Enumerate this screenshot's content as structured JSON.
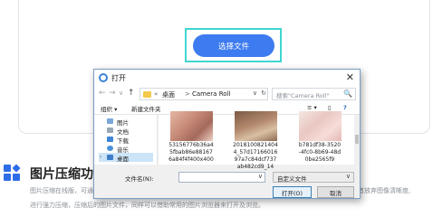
{
  "page": {
    "select_button": "选择文件",
    "feature_title": "图片压缩功能",
    "feature_desc_line1_left": "图片压缩在线版，可通",
    "feature_desc_line1_right": "者放弃图像清晰度,",
    "feature_desc_line2": "进行强力压缩，压缩后的图片文件，同样可以借助常用的图片浏览器来打开及浏览。"
  },
  "dialog": {
    "title": "打开",
    "close_glyph": "✕",
    "nav": {
      "back": "←",
      "forward": "→",
      "dropdown": "∨",
      "up": "↑"
    },
    "address": {
      "chevron": "«",
      "segments": [
        "桌面",
        "Camera Roll"
      ],
      "separator": ">",
      "dropdown": "∨",
      "refresh": "↻"
    },
    "search": {
      "placeholder": "搜索\"Camera Roll\"",
      "icon": "🔍"
    },
    "toolbar": {
      "organize": "组织 ▾",
      "new_folder": "新建文件夹",
      "view": "≡ ▾",
      "pane": "▯",
      "help": "?"
    },
    "sidebar": [
      {
        "label": "图片"
      },
      {
        "label": "文档"
      },
      {
        "label": "下载"
      },
      {
        "label": "音乐"
      },
      {
        "label": "桌面",
        "selected": true
      }
    ],
    "files": [
      {
        "name": "53156776b36a4\n5fbab86e88167\n6a84f4f400x400"
      },
      {
        "name": "2018100821404\n4_57d17166016\n97a7c84dcf737\nab482cd9_14"
      },
      {
        "name": "b781df38-3520\n-4fc0-8b69-48d\n0be2565f9"
      }
    ],
    "filename_label": "文件名(N):",
    "filename_value": "",
    "filter_value": "自定义文件",
    "open_button": "打开(O)",
    "cancel_button": "取消"
  },
  "colors": {
    "primary_button": "#3d7bf0",
    "highlight_border": "#3fd6d0",
    "feature_icon": "#2f6de8",
    "selected_nav": "#cce4f7"
  }
}
